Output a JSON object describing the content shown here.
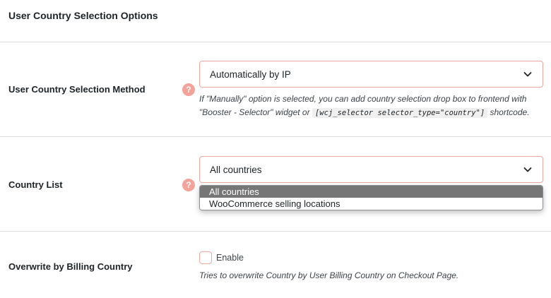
{
  "section": {
    "title": "User Country Selection Options"
  },
  "method": {
    "label": "User Country Selection Method",
    "help_symbol": "?",
    "selected": "Automatically by IP",
    "desc_part1": "If \"Manually\" option is selected, you can add country selection drop box to frontend with",
    "desc_part2": "\"Booster - Selector\" widget or",
    "shortcode": "[wcj_selector selector_type=\"country\"]",
    "desc_part3": "shortcode."
  },
  "country_list": {
    "label": "Country List",
    "help_symbol": "?",
    "selected": "All countries",
    "options": [
      "All countries",
      "WooCommerce selling locations"
    ]
  },
  "billing": {
    "label": "Overwrite by Billing Country",
    "checkbox_label": "Enable",
    "checked": false,
    "desc": "Tries to overwrite Country by User Billing Country on Checkout Page."
  },
  "colors": {
    "accent_border": "#f0a79f",
    "help_icon": "#f4a39a",
    "selected_option": "#767676"
  }
}
